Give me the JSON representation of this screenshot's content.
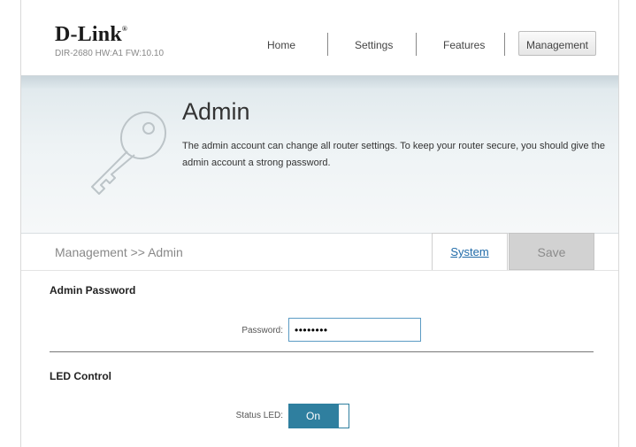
{
  "header": {
    "brand": "D-Link",
    "model_info": "DIR-2680 HW:A1 FW:10.10",
    "nav": [
      {
        "label": "Home"
      },
      {
        "label": "Settings"
      },
      {
        "label": "Features"
      },
      {
        "label": "Management",
        "active": true
      }
    ]
  },
  "banner": {
    "icon": "key-icon",
    "title": "Admin",
    "description": "The admin account can change all router settings. To keep your router secure, you should give the admin account a strong password."
  },
  "toolbar": {
    "breadcrumb": "Management >> Admin",
    "system_label": "System",
    "save_label": "Save"
  },
  "admin_password": {
    "section_title": "Admin Password",
    "password_label": "Password:",
    "password_value": "••••••••"
  },
  "led_control": {
    "section_title": "LED Control",
    "status_led_label": "Status LED:",
    "status_led_value": "On"
  },
  "colors": {
    "accent": "#2f7f9f",
    "link": "#1f6aa8",
    "input_border": "#5b9bc4"
  }
}
